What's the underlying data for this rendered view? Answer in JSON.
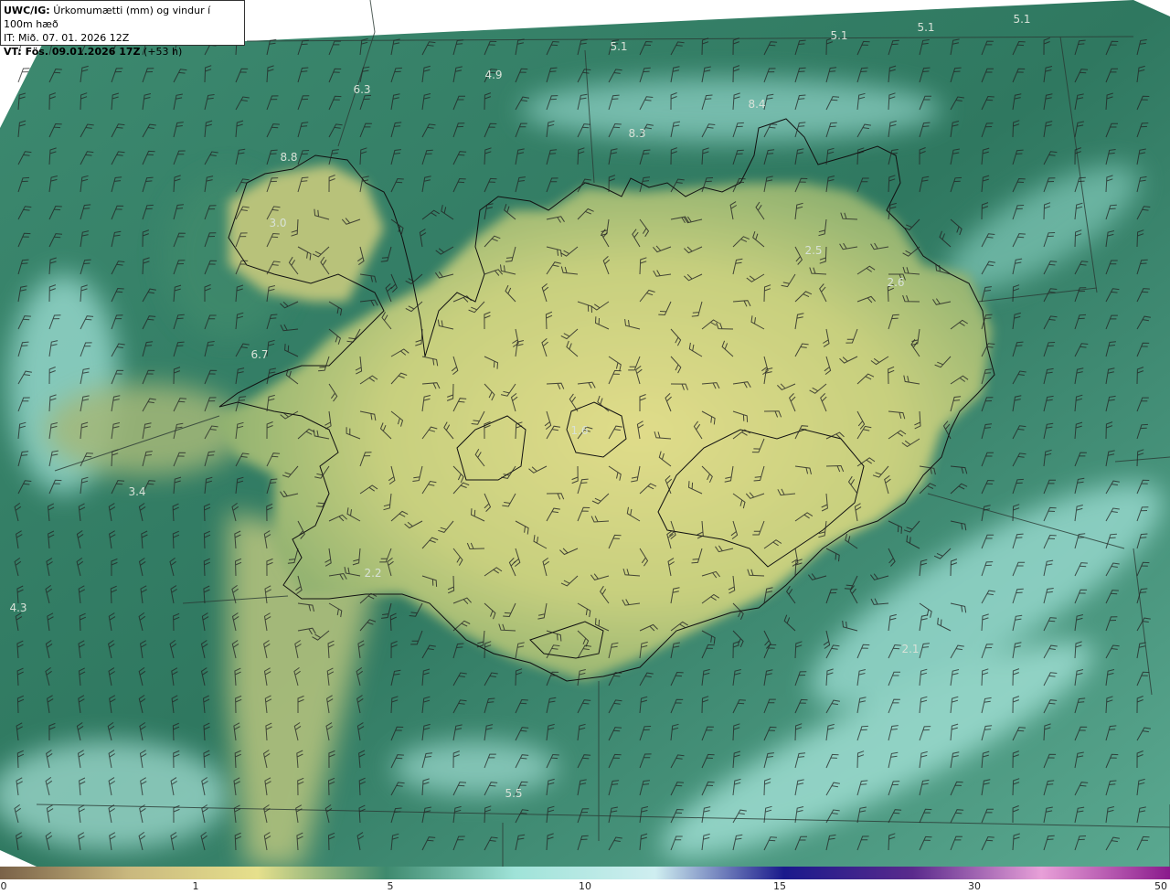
{
  "header": {
    "line1_bold": "UWC/IG:",
    "line1_text": "Úrkomumætti (mm) og vindur í 100m hæð",
    "line2": "IT: Mið. 07. 01. 2026 12Z",
    "line3_bold": "VT: Fös. 09.01.2026 17Z",
    "line3_text": "(+53 h)"
  },
  "map_labels": [
    "5.1",
    "4.9",
    "5.1",
    "5.1",
    "5.1",
    "6.3",
    "8.4",
    "8.3",
    "8.8",
    "3.0",
    "2.5",
    "2.6",
    "6.7",
    "3.4",
    "4.3",
    "2.2",
    "5.5",
    "1.6",
    "2.1"
  ],
  "colorbar": {
    "ticks": [
      "0",
      "1",
      "5",
      "10",
      "15",
      "30",
      "50"
    ],
    "colors": [
      "#7a6248",
      "#c9b87e",
      "#e6e08c",
      "#3e8a6e",
      "#9fe3d8",
      "#cfeef0",
      "#1a1a8c",
      "#5a2a8c",
      "#e8a0d8",
      "#8a1a8c"
    ]
  },
  "colors": {
    "sea_dark": "#2f7a62",
    "sea_mid": "#4a9a80",
    "sea_light": "#8fd6cc",
    "land_yellow": "#d8d684",
    "land_green": "#9ab874",
    "coast": "#111111",
    "barb": "#222222"
  }
}
